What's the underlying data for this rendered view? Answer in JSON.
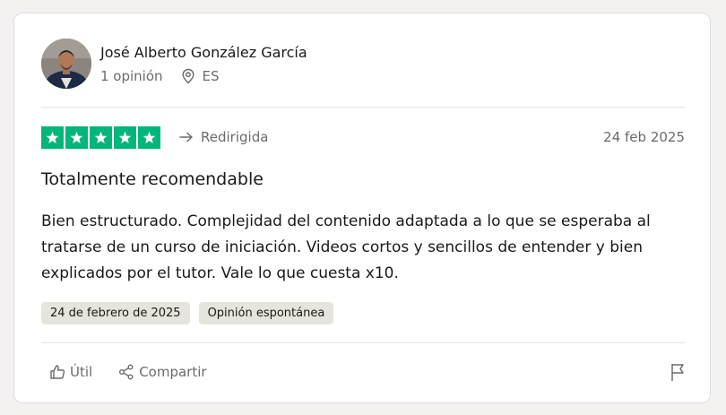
{
  "reviewer": {
    "name": "José Alberto González García",
    "review_count": "1 opinión",
    "country": "ES"
  },
  "rating": {
    "stars": 5,
    "max_stars": 5,
    "color": "#00b67a"
  },
  "status": {
    "redirected_label": "Redirigida"
  },
  "review": {
    "date_short": "24 feb 2025",
    "title": "Totalmente recomendable",
    "body": "Bien estructurado. Complejidad del contenido adaptada a lo que se esperaba al tratarse de un curso de iniciación. Videos cortos y sencillos de entender y bien explicados por el tutor. Vale lo que cuesta x10."
  },
  "tags": [
    "24 de febrero de 2025",
    "Opinión espontánea"
  ],
  "actions": {
    "useful_label": "Útil",
    "share_label": "Compartir"
  },
  "icons": {
    "location": "location-pin-icon",
    "redirect": "arrow-right-icon",
    "useful": "thumbs-up-icon",
    "share": "share-icon",
    "report": "flag-icon"
  }
}
